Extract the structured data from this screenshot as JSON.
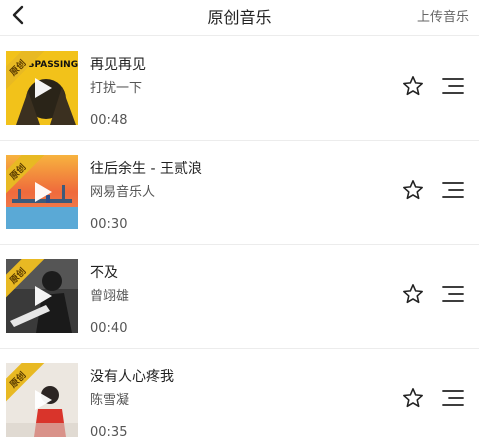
{
  "header": {
    "back_icon": "chevron-left-icon",
    "title": "原创音乐",
    "upload_label": "上传音乐"
  },
  "badge_label": "原创",
  "songs": [
    {
      "title": "再见再见",
      "artist": "打扰一下",
      "duration": "00:48",
      "cover_text": "ESPASSING"
    },
    {
      "title": "往后余生 - 王贰浪",
      "artist": "网易音乐人",
      "duration": "00:30"
    },
    {
      "title": "不及",
      "artist": "曾翊雄",
      "duration": "00:40"
    },
    {
      "title": "没有人心疼我",
      "artist": "陈雪凝",
      "duration": "00:35"
    }
  ],
  "colors": {
    "badge": "#e8b923",
    "divider": "#ececec"
  }
}
